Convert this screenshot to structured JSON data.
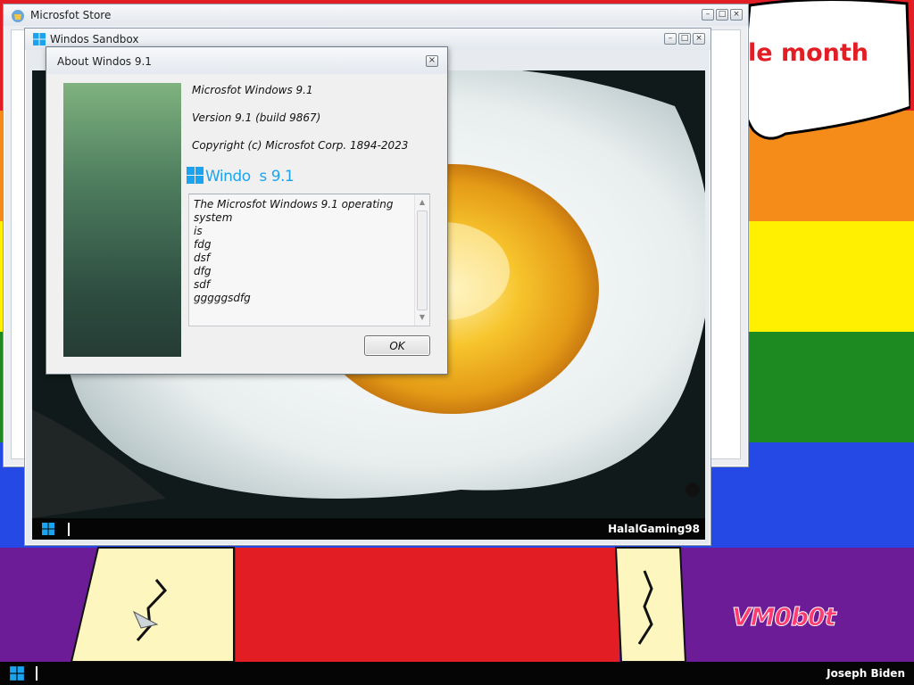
{
  "desktop": {
    "speech_text": "le month",
    "watermark": "VM0b0t"
  },
  "taskbar": {
    "user_name": "Joseph Biden"
  },
  "store_window": {
    "title": "Microsfot Store"
  },
  "sandbox_window": {
    "title": "Windos Sandbox",
    "taskbar_user": "HalalGaming98"
  },
  "about_dialog": {
    "title": "About Windos 9.1",
    "product_name": "Microsfot Windows 9.1",
    "version": "Version 9.1 (build 9867)",
    "copyright": "Copyright (c) Microsfot Corp. 1894-2023",
    "logo_text": "Windo  s 9.1",
    "description_lines": [
      "The Microsfot Windows 9.1 operating system",
      "is",
      "fdg",
      "dsf",
      "dfg",
      "sdf",
      "gggggsdfg"
    ],
    "ok_label": "OK"
  },
  "colors": {
    "accent_blue": "#1aa4f0",
    "taskbar": "#050505",
    "speech_red": "#e21d24"
  },
  "icons": {
    "start": "windows-logo-icon",
    "store": "store-icon",
    "sandbox": "windows-logo-icon"
  }
}
